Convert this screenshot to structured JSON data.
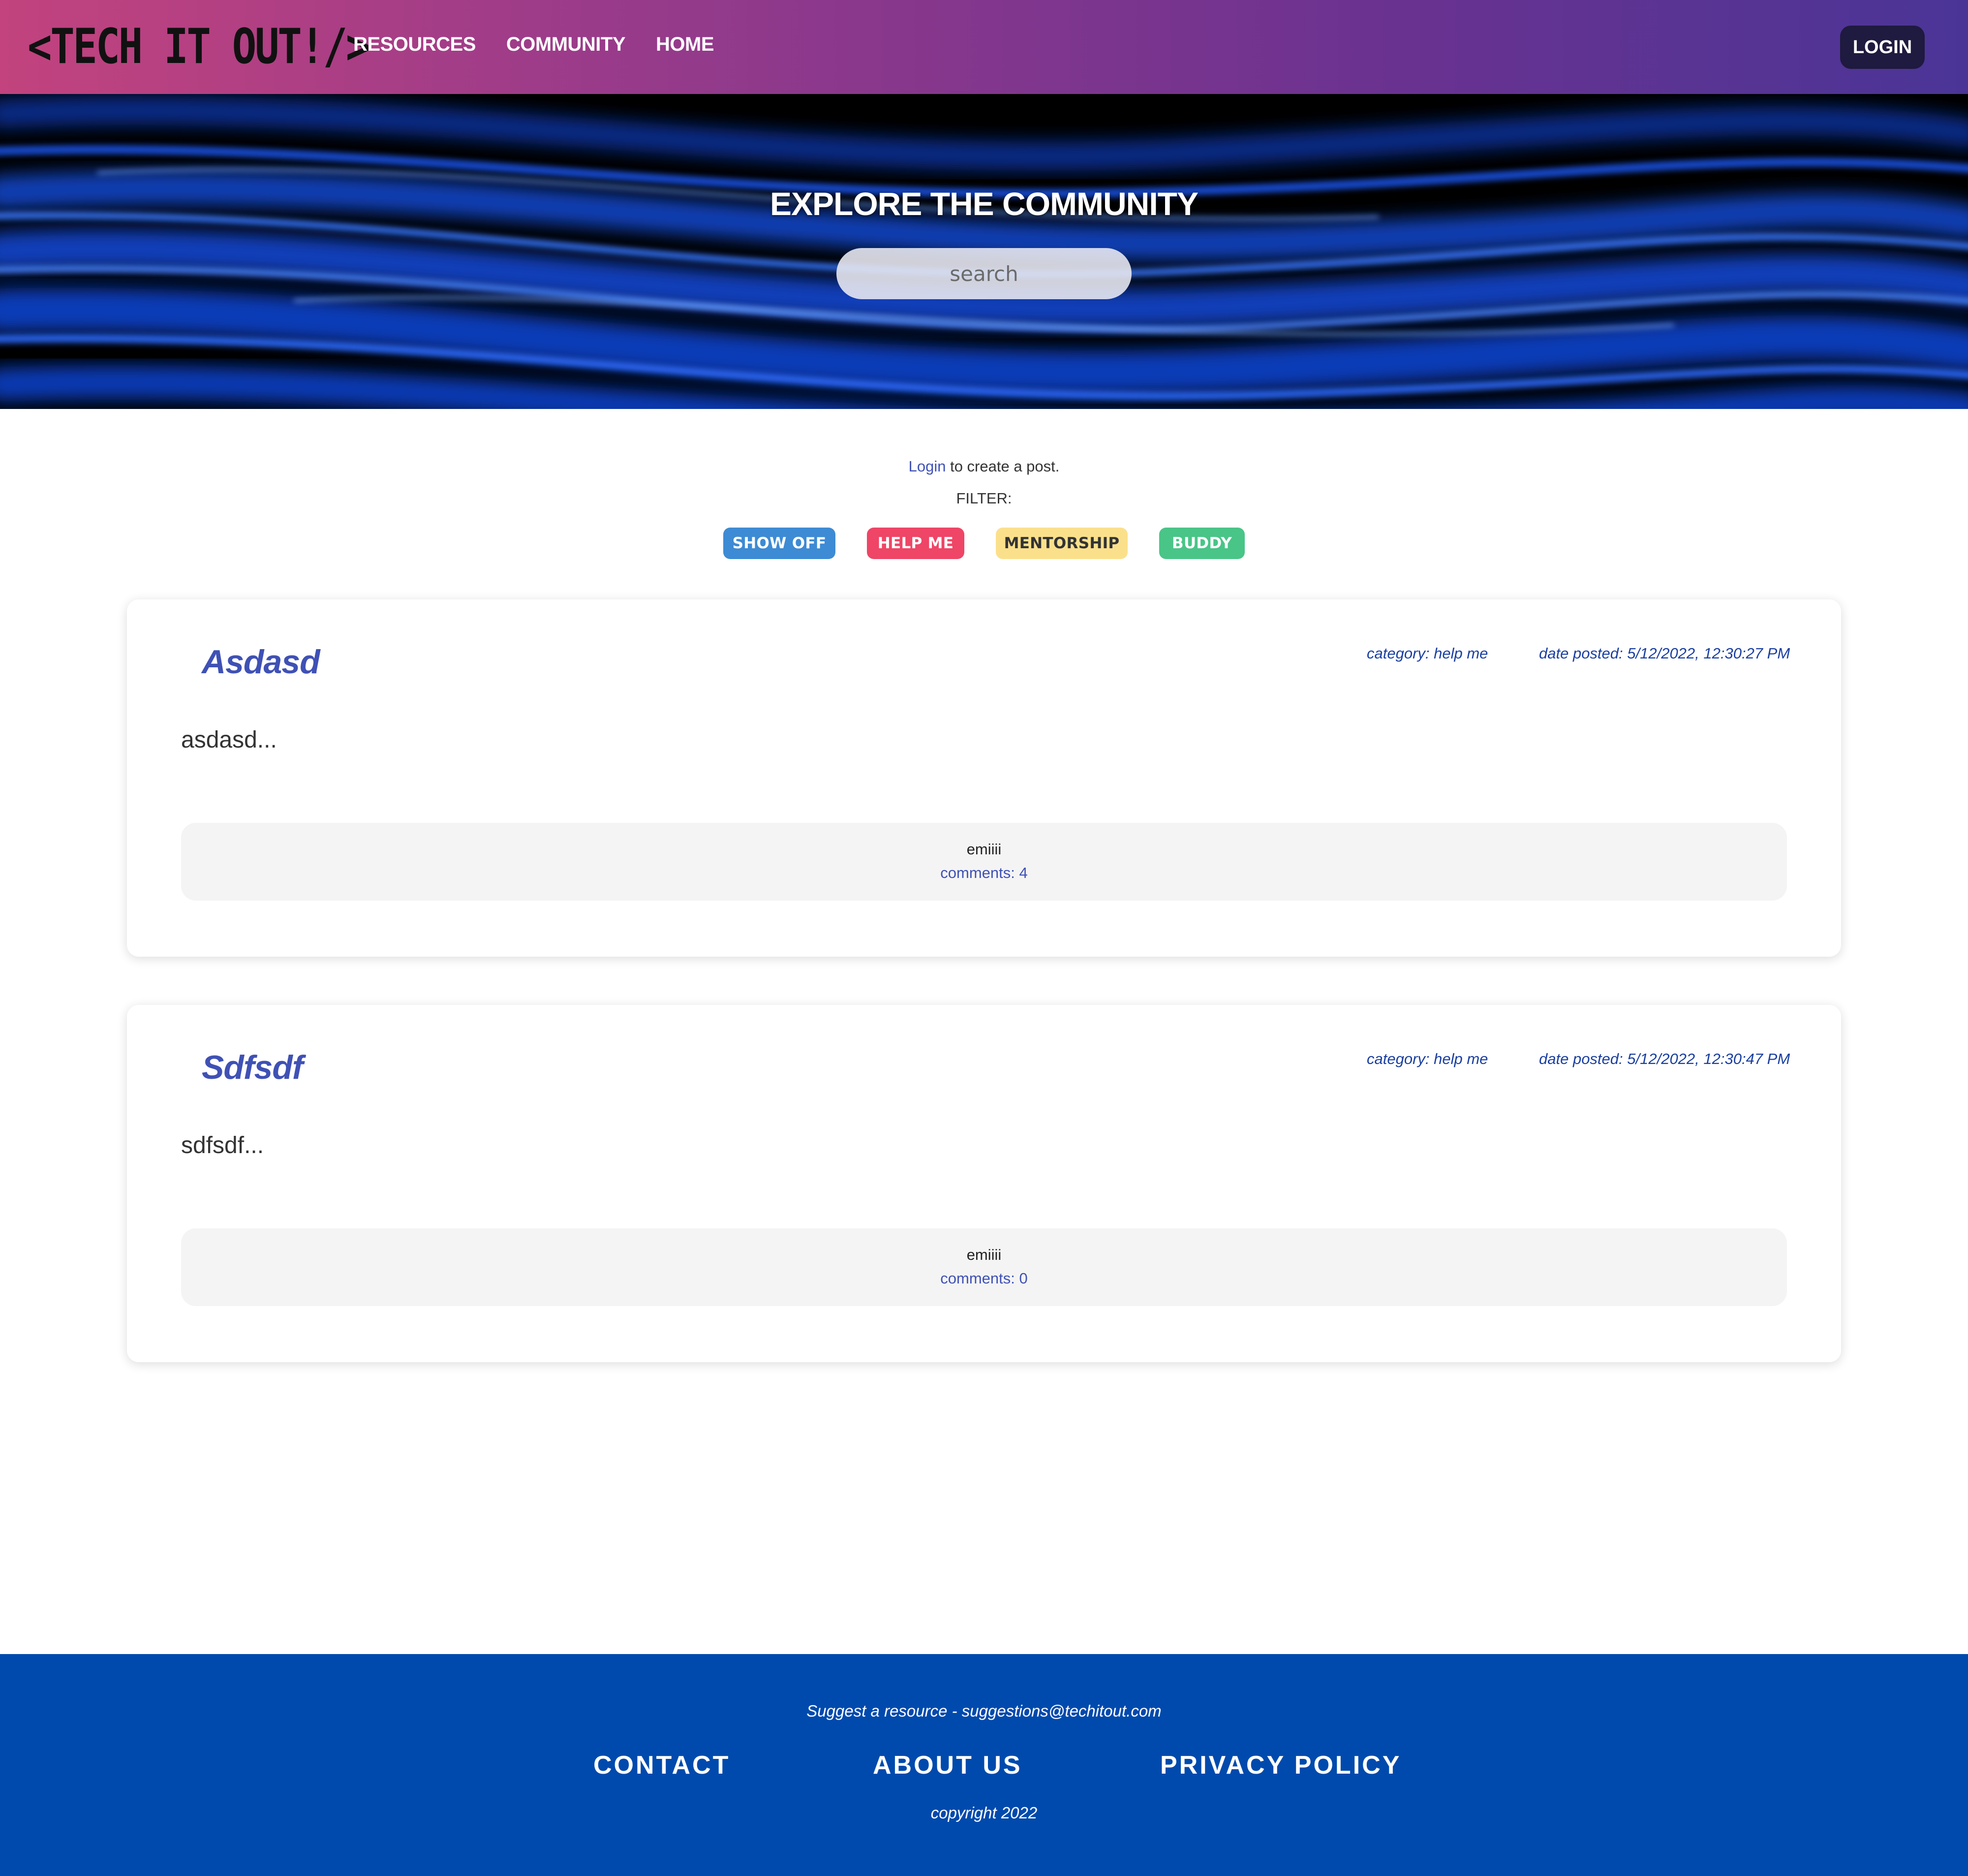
{
  "header": {
    "logo_text": "<TECH IT OUT!/>",
    "nav": [
      {
        "label": "RESOURCES"
      },
      {
        "label": "COMMUNITY"
      },
      {
        "label": "HOME"
      }
    ],
    "login_label": "LOGIN"
  },
  "hero": {
    "title": "EXPLORE THE COMMUNITY",
    "search_placeholder": "search"
  },
  "controls": {
    "login_link": "Login",
    "login_hint_rest": " to create a post.",
    "filter_label": "FILTER:",
    "filters": [
      {
        "label": "SHOW OFF",
        "color": "#3d8bd4"
      },
      {
        "label": "HELP ME",
        "color": "#ef4566"
      },
      {
        "label": "MENTORSHIP",
        "color": "#fbe08c"
      },
      {
        "label": "BUDDY",
        "color": "#48c587"
      }
    ]
  },
  "posts": [
    {
      "title": "Asdasd",
      "category": "category: help me",
      "date": "date posted: 5/12/2022, 12:30:27 PM",
      "body": "asdasd...",
      "author": "emiiii",
      "comments": "comments: 4"
    },
    {
      "title": "Sdfsdf",
      "category": "category: help me",
      "date": "date posted: 5/12/2022, 12:30:47 PM",
      "body": "sdfsdf...",
      "author": "emiiii",
      "comments": "comments: 0"
    }
  ],
  "footer": {
    "suggest": "Suggest a resource - suggestions@techitout.com",
    "links": [
      {
        "label": "CONTACT"
      },
      {
        "label": "ABOUT US"
      },
      {
        "label": "PRIVACY POLICY"
      }
    ],
    "copyright": "copyright 2022"
  },
  "colors": {
    "nav_gradient_start": "#c2437e",
    "nav_gradient_end": "#4a3596",
    "accent_link": "#3f51b5",
    "footer_bg": "#004aad"
  }
}
